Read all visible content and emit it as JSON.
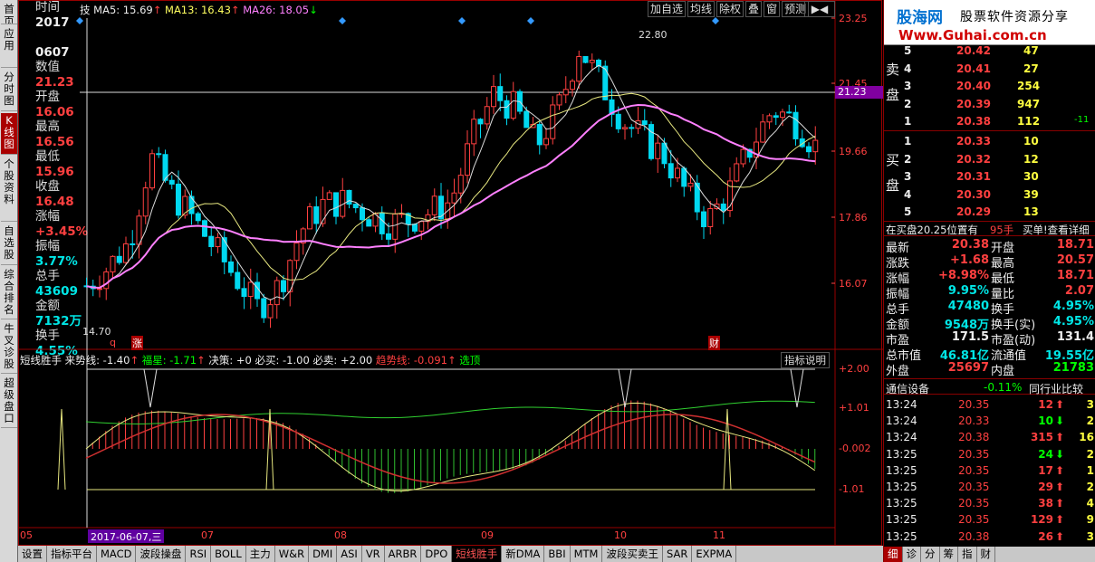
{
  "left_tabs": [
    {
      "label": "首\n页"
    },
    {
      "label": "应\n用"
    },
    {
      "label": "分\n时\n图"
    },
    {
      "label": "K\n线\n图",
      "active": true
    },
    {
      "label": "个\n股\n资\n料"
    },
    {
      "label": "自\n选\n股"
    },
    {
      "label": "综\n合\n排\n名"
    },
    {
      "label": "牛\n叉\n诊\n股"
    },
    {
      "label": "超\n级\n盘\n口"
    }
  ],
  "info": [
    {
      "label": "时间",
      "value": "2017"
    },
    {
      "label": "",
      "value": "0607"
    },
    {
      "label": "数值",
      "value": "21.23"
    },
    {
      "label": "开盘",
      "value": "16.06"
    },
    {
      "label": "最高",
      "value": "16.56"
    },
    {
      "label": "最低",
      "value": "15.96"
    },
    {
      "label": "收盘",
      "value": "16.48"
    },
    {
      "label": "涨幅",
      "value": "+3.45%"
    },
    {
      "label": "振幅",
      "value": "3.77%"
    },
    {
      "label": "总手",
      "value": "43609"
    },
    {
      "label": "金额",
      "value": "7132万"
    },
    {
      "label": "换手",
      "value": "4.55%"
    }
  ],
  "ma": {
    "prefix": "技",
    "ma5": "MA5: 15.69",
    "ma13": "MA13: 16.43",
    "ma26": "MA26: 18.05"
  },
  "toolbar": [
    "加自选",
    "均线",
    "除权",
    "叠",
    "窗",
    "预测"
  ],
  "price_axis": [
    "23.25",
    "21.45",
    "19.66",
    "17.86",
    "16.07"
  ],
  "current_value": "21.23",
  "high_label": "22.80",
  "low_label": "14.70",
  "marks": {
    "q": "q",
    "zhang": "涨",
    "cai": "财"
  },
  "indicator": {
    "name": "短线胜手",
    "laishi": "来势线: -1.40",
    "fuxing": "福星: -1.71",
    "juece": "决策: +0",
    "bimai": "必买: -1.00",
    "bimai2": "必卖: +2.00",
    "qushi": "趋势线: -0.091",
    "xuanding": "选顶",
    "help": "指标说明"
  },
  "ind_axis": [
    "+2.00",
    "+1.01",
    "-0.002",
    "-1.01"
  ],
  "date_cursor": "2017-06-07,三",
  "months": [
    "05",
    "07",
    "08",
    "09",
    "10",
    "11"
  ],
  "bottom_tabs": [
    "设置",
    "指标平台",
    "MACD",
    "波段操盘",
    "RSI",
    "BOLL",
    "主力",
    "W&R",
    "DMI",
    "ASI",
    "VR",
    "ARBR",
    "DPO",
    "短线胜手",
    "新DMA",
    "BBI",
    "MTM",
    "波段买卖王",
    "SAR",
    "EXPMA"
  ],
  "active_bottom_tab": "短线胜手",
  "brand": {
    "logo": "股海网",
    "slogan": "股票软件资源分享",
    "url": "Www.Guhai.com.cn"
  },
  "sell": [
    {
      "n": "5",
      "p": "20.42",
      "v": "47"
    },
    {
      "n": "4",
      "p": "20.41",
      "v": "27"
    },
    {
      "n": "3",
      "p": "20.40",
      "v": "254"
    },
    {
      "n": "2",
      "p": "20.39",
      "v": "947"
    },
    {
      "n": "1",
      "p": "20.38",
      "v": "112",
      "c": "-11"
    }
  ],
  "sell_label": [
    "卖",
    "盘"
  ],
  "buy": [
    {
      "n": "1",
      "p": "20.33",
      "v": "10"
    },
    {
      "n": "2",
      "p": "20.32",
      "v": "12"
    },
    {
      "n": "3",
      "p": "20.31",
      "v": "30"
    },
    {
      "n": "4",
      "p": "20.30",
      "v": "39"
    },
    {
      "n": "5",
      "p": "20.29",
      "v": "13"
    }
  ],
  "buy_label": [
    "买",
    "盘"
  ],
  "summary": {
    "left": "在买盘20.25位置有",
    "mid": "95手",
    "right": "买单!查看详细"
  },
  "stats": [
    [
      "最新",
      "20.38",
      "开盘",
      "18.71"
    ],
    [
      "涨跌",
      "+1.68",
      "最高",
      "20.57"
    ],
    [
      "涨幅",
      "+8.98%",
      "最低",
      "18.71"
    ],
    [
      "振幅",
      "9.95%",
      "量比",
      "2.07"
    ],
    [
      "总手",
      "47480",
      "换手",
      "4.95%"
    ],
    [
      "金额",
      "9548万",
      "换手(实)",
      "4.95%"
    ],
    [
      "市盈",
      "171.5",
      "市盈(动)",
      "131.4"
    ],
    [
      "总市值",
      "46.81亿",
      "流通值",
      "19.55亿"
    ],
    [
      "外盘",
      "25697",
      "内盘",
      "21783"
    ]
  ],
  "sector": {
    "name": "通信设备",
    "pct": "-0.11%",
    "link": "同行业比较"
  },
  "ticks": [
    {
      "t": "13:24",
      "p": "20.35",
      "v": "12",
      "d": "up",
      "n": "3"
    },
    {
      "t": "13:24",
      "p": "20.33",
      "v": "10",
      "d": "down",
      "n": "2"
    },
    {
      "t": "13:24",
      "p": "20.38",
      "v": "315",
      "d": "up",
      "n": "16"
    },
    {
      "t": "13:25",
      "p": "20.35",
      "v": "24",
      "d": "down",
      "n": "2"
    },
    {
      "t": "13:25",
      "p": "20.35",
      "v": "17",
      "d": "up",
      "n": "1"
    },
    {
      "t": "13:25",
      "p": "20.35",
      "v": "29",
      "d": "up",
      "n": "2"
    },
    {
      "t": "13:25",
      "p": "20.35",
      "v": "38",
      "d": "up",
      "n": "4"
    },
    {
      "t": "13:25",
      "p": "20.35",
      "v": "129",
      "d": "up",
      "n": "9"
    },
    {
      "t": "13:25",
      "p": "20.38",
      "v": "26",
      "d": "up",
      "n": "3"
    }
  ],
  "right_tabs": [
    "细",
    "诊",
    "分",
    "筹",
    "指",
    "财"
  ]
}
